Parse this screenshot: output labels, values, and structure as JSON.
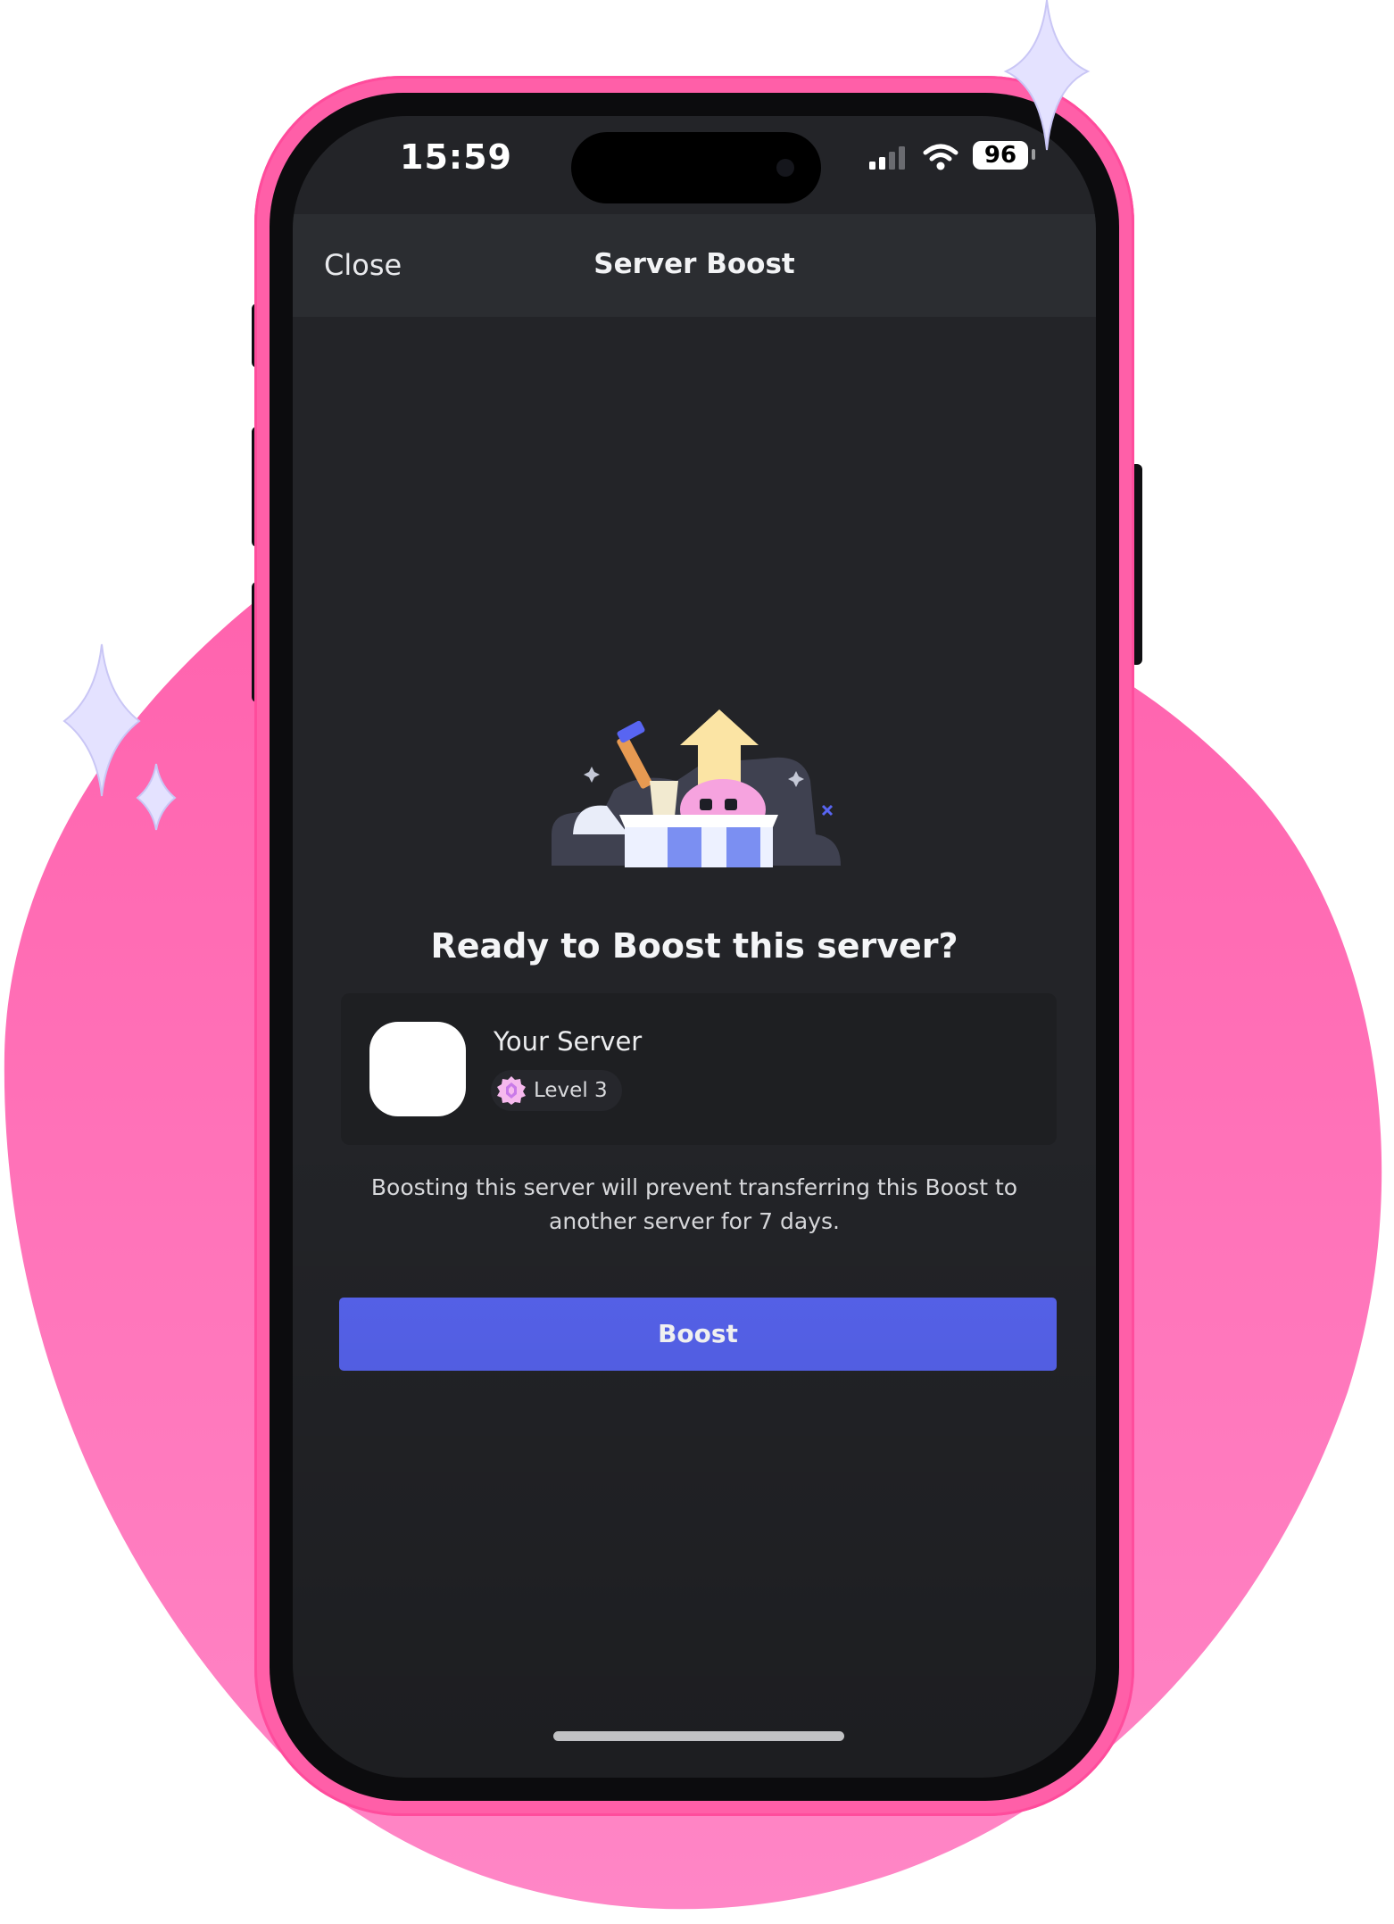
{
  "status_bar": {
    "time": "15:59",
    "battery": "96",
    "signal_icon": "cellular-signal-icon",
    "wifi_icon": "wifi-icon"
  },
  "nav": {
    "close_label": "Close",
    "title": "Server Boost"
  },
  "main": {
    "heading": "Ready to Boost this server?",
    "server": {
      "name": "Your Server",
      "level_label": "Level 3",
      "badge_icon": "boost-level-badge-icon"
    },
    "description": "Boosting this server will prevent transferring this Boost to another server for 7 days.",
    "boost_label": "Boost"
  },
  "colors": {
    "background_blob": "#ff6ab2",
    "phone_frame": "#ff5fa8",
    "screen_bg": "#232428",
    "nav_bg": "#2b2d31",
    "card_bg": "#1e1f22",
    "accent": "#5865f2",
    "sparkle": "#e4e2ff"
  },
  "illustration_icon": "boost-gift-box-illustration"
}
